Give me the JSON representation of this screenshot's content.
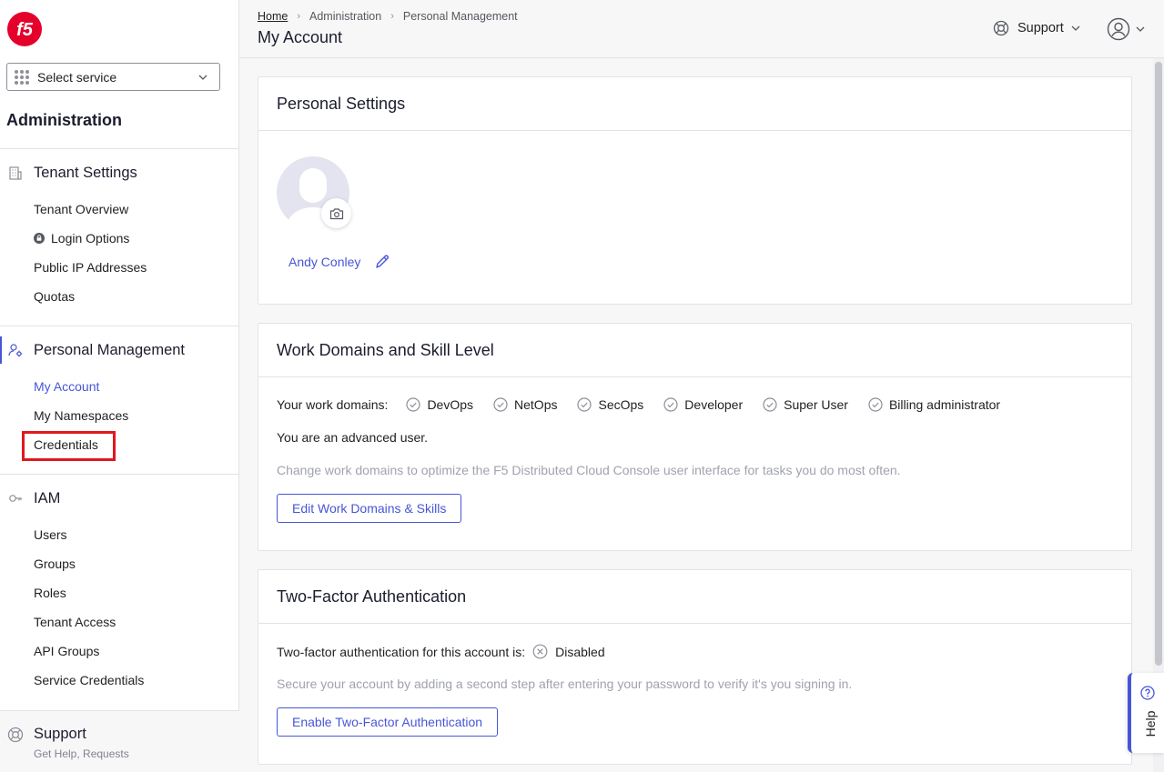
{
  "sidebar": {
    "service_select": "Select service",
    "title": "Administration",
    "sections": [
      {
        "label": "Tenant Settings",
        "items": [
          "Tenant Overview",
          "Login Options",
          "Public IP Addresses",
          "Quotas"
        ]
      },
      {
        "label": "Personal Management",
        "items": [
          "My Account",
          "My Namespaces",
          "Credentials"
        ]
      },
      {
        "label": "IAM",
        "items": [
          "Users",
          "Groups",
          "Roles",
          "Tenant Access",
          "API Groups",
          "Service Credentials"
        ]
      }
    ],
    "support": {
      "title": "Support",
      "subtitle": "Get Help, Requests"
    }
  },
  "header": {
    "breadcrumb": [
      "Home",
      "Administration",
      "Personal Management"
    ],
    "title": "My Account",
    "support_label": "Support"
  },
  "personal_settings": {
    "title": "Personal Settings",
    "user_name": "Andy Conley"
  },
  "work_domains": {
    "title": "Work Domains and Skill Level",
    "label": "Your work domains:",
    "domains": [
      "DevOps",
      "NetOps",
      "SecOps",
      "Developer",
      "Super User",
      "Billing administrator"
    ],
    "level_text": "You are an advanced user.",
    "hint": "Change work domains to optimize the F5 Distributed Cloud Console user interface for tasks you do most often.",
    "button": "Edit Work Domains & Skills"
  },
  "two_factor": {
    "title": "Two-Factor Authentication",
    "label": "Two-factor authentication for this account is:",
    "status": "Disabled",
    "hint": "Secure your account by adding a second step after entering your password to verify it's you signing in.",
    "button": "Enable Two-Factor Authentication"
  },
  "help_label": "Help",
  "colors": {
    "accent": "#4756d6",
    "brand_red": "#e4002b",
    "highlight": "#e0181f"
  }
}
